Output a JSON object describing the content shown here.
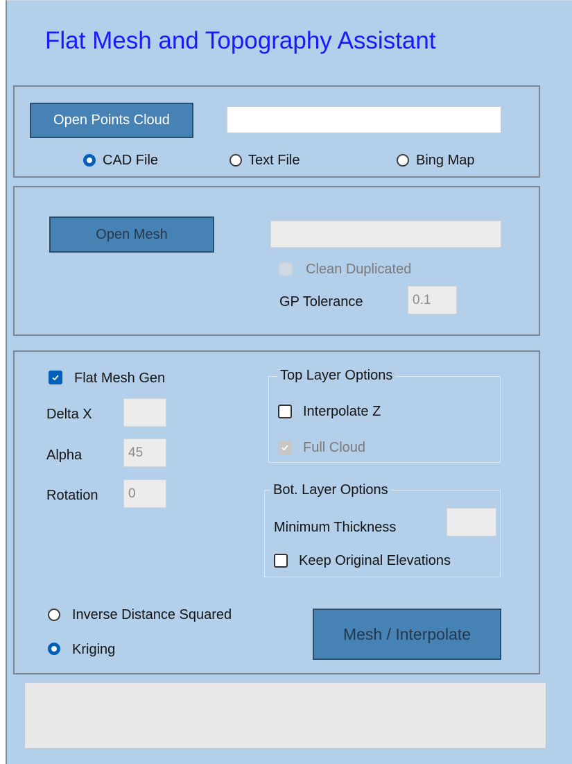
{
  "title": "Flat Mesh and Topography Assistant",
  "points_cloud": {
    "open_button": "Open Points Cloud",
    "path_value": "",
    "source_options": [
      {
        "label": "CAD File",
        "checked": true
      },
      {
        "label": "Text File",
        "checked": false
      },
      {
        "label": "Bing Map",
        "checked": false
      }
    ]
  },
  "mesh": {
    "open_button": "Open Mesh",
    "path_value": "",
    "clean_duplicated_label": "Clean Duplicated",
    "clean_duplicated_checked": false,
    "gp_tolerance_label": "GP Tolerance",
    "gp_tolerance_value": "0.1"
  },
  "flat_mesh": {
    "gen_label": "Flat Mesh Gen",
    "gen_checked": true,
    "delta_x_label": "Delta X",
    "delta_x_value": "",
    "alpha_label": "Alpha",
    "alpha_value": "45",
    "rotation_label": "Rotation",
    "rotation_value": "0"
  },
  "top_layer": {
    "legend": "Top Layer Options",
    "interpolate_z_label": "Interpolate Z",
    "interpolate_z_checked": false,
    "full_cloud_label": "Full Cloud",
    "full_cloud_checked": true
  },
  "bot_layer": {
    "legend": "Bot. Layer Options",
    "min_thickness_label": "Minimum Thickness",
    "min_thickness_value": "",
    "keep_elevations_label": "Keep Original Elevations",
    "keep_elevations_checked": false
  },
  "interpolation": {
    "options": [
      {
        "label": "Inverse Distance Squared",
        "checked": false
      },
      {
        "label": "Kriging",
        "checked": true
      }
    ],
    "run_button": "Mesh / Interpolate"
  },
  "colors": {
    "background": "#b3cfe9",
    "title": "#1a1aff",
    "button": "#4682b4",
    "accent": "#005fb8"
  }
}
